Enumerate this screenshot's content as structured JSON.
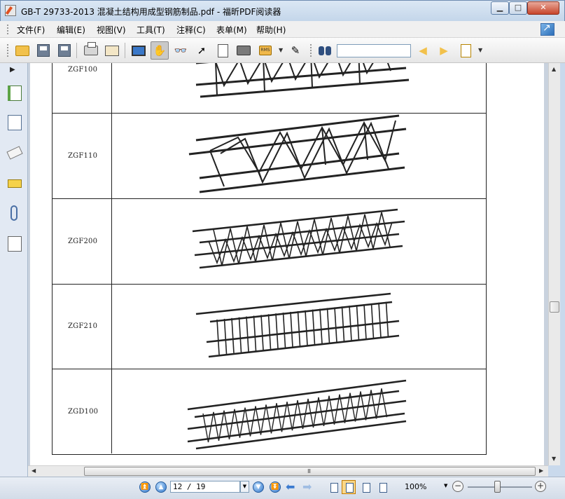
{
  "window": {
    "title": "GB-T 29733-2013  混凝土结构用成型钢筋制品.pdf - 福昕PDF阅读器",
    "min_label": "▁",
    "max_label": "□",
    "close_label": "✕"
  },
  "menu": {
    "items": [
      "文件(F)",
      "编辑(E)",
      "视图(V)",
      "工具(T)",
      "注释(C)",
      "表单(M)",
      "帮助(H)"
    ]
  },
  "toolbar": {
    "search_value": "",
    "icons": [
      "open-folder-icon",
      "save-icon",
      "save-as-icon",
      "print-icon",
      "scan-icon",
      "fullscreen-icon",
      "hand-tool-icon",
      "zoom-tool-icon",
      "select-tool-icon",
      "text-select-icon",
      "snapshot-icon",
      "rms-icon",
      "sign-icon",
      "find-icon",
      "find-prev-icon",
      "find-next-icon",
      "highlight-icon"
    ],
    "rms_label": "RMS"
  },
  "document": {
    "rows": [
      {
        "label": "ZGF100"
      },
      {
        "label": "ZGF110"
      },
      {
        "label": "ZGF200"
      },
      {
        "label": "ZGF210"
      },
      {
        "label": "ZGD100"
      }
    ]
  },
  "hscroll": {
    "grip": "III"
  },
  "statusbar": {
    "page_value": "12 / 19",
    "zoom_value": "100%",
    "zoom_out": "−",
    "zoom_in": "+"
  }
}
